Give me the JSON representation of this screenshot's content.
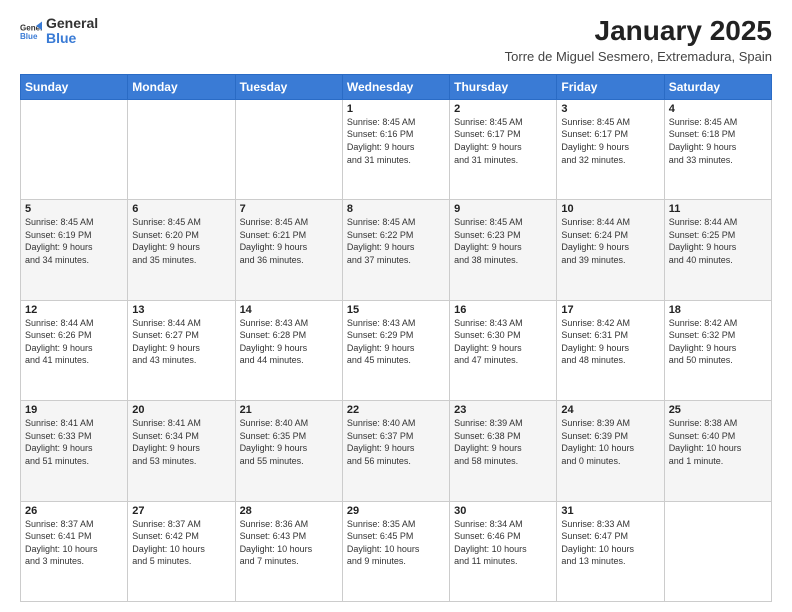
{
  "logo": {
    "text_general": "General",
    "text_blue": "Blue"
  },
  "header": {
    "title": "January 2025",
    "subtitle": "Torre de Miguel Sesmero, Extremadura, Spain"
  },
  "weekdays": [
    "Sunday",
    "Monday",
    "Tuesday",
    "Wednesday",
    "Thursday",
    "Friday",
    "Saturday"
  ],
  "weeks": [
    [
      {
        "day": "",
        "content": ""
      },
      {
        "day": "",
        "content": ""
      },
      {
        "day": "",
        "content": ""
      },
      {
        "day": "1",
        "content": "Sunrise: 8:45 AM\nSunset: 6:16 PM\nDaylight: 9 hours\nand 31 minutes."
      },
      {
        "day": "2",
        "content": "Sunrise: 8:45 AM\nSunset: 6:17 PM\nDaylight: 9 hours\nand 31 minutes."
      },
      {
        "day": "3",
        "content": "Sunrise: 8:45 AM\nSunset: 6:17 PM\nDaylight: 9 hours\nand 32 minutes."
      },
      {
        "day": "4",
        "content": "Sunrise: 8:45 AM\nSunset: 6:18 PM\nDaylight: 9 hours\nand 33 minutes."
      }
    ],
    [
      {
        "day": "5",
        "content": "Sunrise: 8:45 AM\nSunset: 6:19 PM\nDaylight: 9 hours\nand 34 minutes."
      },
      {
        "day": "6",
        "content": "Sunrise: 8:45 AM\nSunset: 6:20 PM\nDaylight: 9 hours\nand 35 minutes."
      },
      {
        "day": "7",
        "content": "Sunrise: 8:45 AM\nSunset: 6:21 PM\nDaylight: 9 hours\nand 36 minutes."
      },
      {
        "day": "8",
        "content": "Sunrise: 8:45 AM\nSunset: 6:22 PM\nDaylight: 9 hours\nand 37 minutes."
      },
      {
        "day": "9",
        "content": "Sunrise: 8:45 AM\nSunset: 6:23 PM\nDaylight: 9 hours\nand 38 minutes."
      },
      {
        "day": "10",
        "content": "Sunrise: 8:44 AM\nSunset: 6:24 PM\nDaylight: 9 hours\nand 39 minutes."
      },
      {
        "day": "11",
        "content": "Sunrise: 8:44 AM\nSunset: 6:25 PM\nDaylight: 9 hours\nand 40 minutes."
      }
    ],
    [
      {
        "day": "12",
        "content": "Sunrise: 8:44 AM\nSunset: 6:26 PM\nDaylight: 9 hours\nand 41 minutes."
      },
      {
        "day": "13",
        "content": "Sunrise: 8:44 AM\nSunset: 6:27 PM\nDaylight: 9 hours\nand 43 minutes."
      },
      {
        "day": "14",
        "content": "Sunrise: 8:43 AM\nSunset: 6:28 PM\nDaylight: 9 hours\nand 44 minutes."
      },
      {
        "day": "15",
        "content": "Sunrise: 8:43 AM\nSunset: 6:29 PM\nDaylight: 9 hours\nand 45 minutes."
      },
      {
        "day": "16",
        "content": "Sunrise: 8:43 AM\nSunset: 6:30 PM\nDaylight: 9 hours\nand 47 minutes."
      },
      {
        "day": "17",
        "content": "Sunrise: 8:42 AM\nSunset: 6:31 PM\nDaylight: 9 hours\nand 48 minutes."
      },
      {
        "day": "18",
        "content": "Sunrise: 8:42 AM\nSunset: 6:32 PM\nDaylight: 9 hours\nand 50 minutes."
      }
    ],
    [
      {
        "day": "19",
        "content": "Sunrise: 8:41 AM\nSunset: 6:33 PM\nDaylight: 9 hours\nand 51 minutes."
      },
      {
        "day": "20",
        "content": "Sunrise: 8:41 AM\nSunset: 6:34 PM\nDaylight: 9 hours\nand 53 minutes."
      },
      {
        "day": "21",
        "content": "Sunrise: 8:40 AM\nSunset: 6:35 PM\nDaylight: 9 hours\nand 55 minutes."
      },
      {
        "day": "22",
        "content": "Sunrise: 8:40 AM\nSunset: 6:37 PM\nDaylight: 9 hours\nand 56 minutes."
      },
      {
        "day": "23",
        "content": "Sunrise: 8:39 AM\nSunset: 6:38 PM\nDaylight: 9 hours\nand 58 minutes."
      },
      {
        "day": "24",
        "content": "Sunrise: 8:39 AM\nSunset: 6:39 PM\nDaylight: 10 hours\nand 0 minutes."
      },
      {
        "day": "25",
        "content": "Sunrise: 8:38 AM\nSunset: 6:40 PM\nDaylight: 10 hours\nand 1 minute."
      }
    ],
    [
      {
        "day": "26",
        "content": "Sunrise: 8:37 AM\nSunset: 6:41 PM\nDaylight: 10 hours\nand 3 minutes."
      },
      {
        "day": "27",
        "content": "Sunrise: 8:37 AM\nSunset: 6:42 PM\nDaylight: 10 hours\nand 5 minutes."
      },
      {
        "day": "28",
        "content": "Sunrise: 8:36 AM\nSunset: 6:43 PM\nDaylight: 10 hours\nand 7 minutes."
      },
      {
        "day": "29",
        "content": "Sunrise: 8:35 AM\nSunset: 6:45 PM\nDaylight: 10 hours\nand 9 minutes."
      },
      {
        "day": "30",
        "content": "Sunrise: 8:34 AM\nSunset: 6:46 PM\nDaylight: 10 hours\nand 11 minutes."
      },
      {
        "day": "31",
        "content": "Sunrise: 8:33 AM\nSunset: 6:47 PM\nDaylight: 10 hours\nand 13 minutes."
      },
      {
        "day": "",
        "content": ""
      }
    ]
  ]
}
